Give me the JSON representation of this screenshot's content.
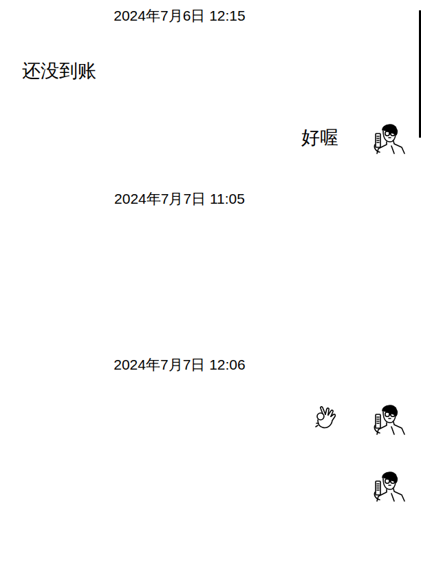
{
  "messages": [
    {
      "kind": "timestamp",
      "text": "2024年7月6日 12:15"
    },
    {
      "kind": "text",
      "side": "left",
      "text": "还没到账",
      "avatar": false
    },
    {
      "kind": "text",
      "side": "right",
      "text": "好喔",
      "avatar": true
    },
    {
      "kind": "timestamp",
      "text": "2024年7月7日 11:05"
    },
    {
      "kind": "blank",
      "side": "left",
      "avatar": false
    },
    {
      "kind": "timestamp",
      "text": "2024年7月7日 12:06"
    },
    {
      "kind": "emoji",
      "side": "right",
      "avatar": true
    },
    {
      "kind": "blank",
      "side": "right",
      "avatar": true
    }
  ]
}
